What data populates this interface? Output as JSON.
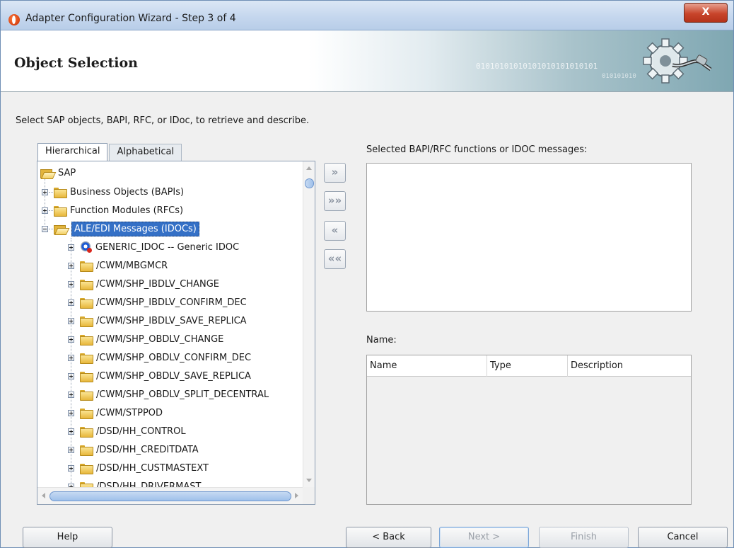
{
  "window": {
    "title": "Adapter Configuration Wizard - Step 3 of 4",
    "close_label": "X"
  },
  "banner": {
    "title": "Object Selection",
    "binary_line1": "01010101010101010101010101",
    "binary_line2": "010101010"
  },
  "instruction": "Select SAP objects, BAPI, RFC, or IDoc, to retrieve and describe.",
  "tabs": [
    {
      "label": "Hierarchical",
      "active": true
    },
    {
      "label": "Alphabetical",
      "active": false
    }
  ],
  "tree": {
    "root": "SAP",
    "level1": [
      {
        "label": "Business Objects (BAPIs)"
      },
      {
        "label": "Function Modules (RFCs)"
      },
      {
        "label": "ALE/EDI Messages (IDOCs)",
        "selected": true
      }
    ],
    "idocs": [
      "GENERIC_IDOC -- Generic IDOC",
      "/CWM/MBGMCR",
      "/CWM/SHP_IBDLV_CHANGE",
      "/CWM/SHP_IBDLV_CONFIRM_DEC",
      "/CWM/SHP_IBDLV_SAVE_REPLICA",
      "/CWM/SHP_OBDLV_CHANGE",
      "/CWM/SHP_OBDLV_CONFIRM_DEC",
      "/CWM/SHP_OBDLV_SAVE_REPLICA",
      "/CWM/SHP_OBDLV_SPLIT_DECENTRAL",
      "/CWM/STPPOD",
      "/DSD/HH_CONTROL",
      "/DSD/HH_CREDITDATA",
      "/DSD/HH_CUSTMASTEXT",
      "/DSD/HH_DRIVERMAST"
    ]
  },
  "move_buttons": {
    "add": "»",
    "add_all": "»»",
    "remove": "«",
    "remove_all": "««"
  },
  "selected_label": "Selected BAPI/RFC functions or IDOC messages:",
  "name_label": "Name:",
  "name_table": {
    "columns": [
      "Name",
      "Type",
      "Description"
    ]
  },
  "buttons": {
    "help": "Help",
    "back": "< Back",
    "next": "Next >",
    "finish": "Finish",
    "cancel": "Cancel"
  },
  "colors": {
    "selection": "#3470c6",
    "close": "#c8452b"
  }
}
